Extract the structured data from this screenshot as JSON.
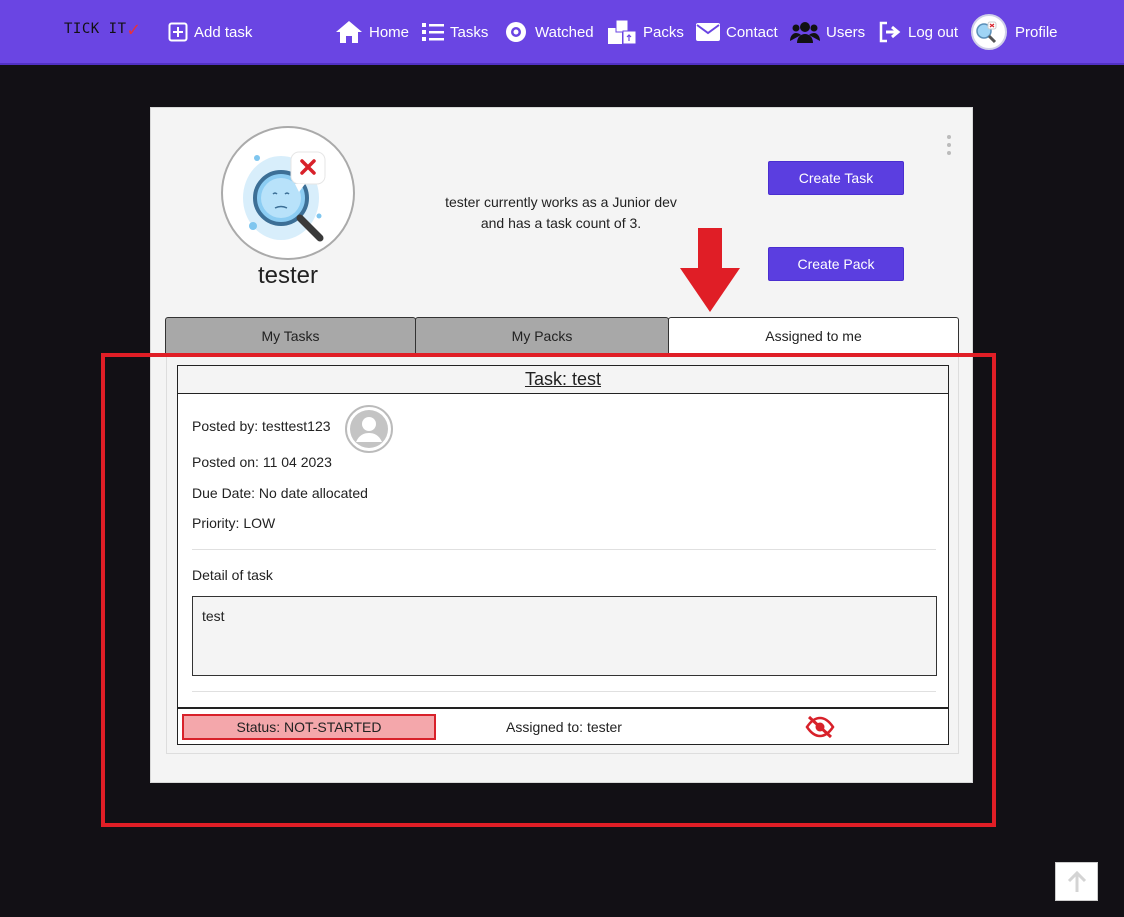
{
  "navbar": {
    "brand": "TICK IT",
    "add_task": "Add task",
    "home": "Home",
    "tasks": "Tasks",
    "watched": "Watched",
    "packs": "Packs",
    "contact": "Contact",
    "users": "Users",
    "logout": "Log out",
    "profile": "Profile"
  },
  "profile": {
    "username": "tester",
    "bio_line1": "tester currently works as a Junior dev",
    "bio_line2": "and has a task count of 3.",
    "create_task": "Create Task",
    "create_pack": "Create Pack"
  },
  "tabs": {
    "my_tasks": "My Tasks",
    "my_packs": "My Packs",
    "assigned": "Assigned to me"
  },
  "task": {
    "title": "Task: test",
    "posted_by": "Posted by: testtest123",
    "posted_on": "Posted on: 11 04 2023",
    "due_date": "Due Date: No date allocated",
    "priority": "Priority: LOW",
    "detail_label": "Detail of task",
    "detail": "test",
    "status": "Status: NOT-STARTED",
    "assigned_to": "Assigned to: tester"
  },
  "colors": {
    "navbar": "#6a45e3",
    "primary_button": "#5b3ee0",
    "status_bg": "#f4a7ab",
    "status_border": "#d8212a",
    "annotation": "#e01e26",
    "background": "#121015"
  }
}
